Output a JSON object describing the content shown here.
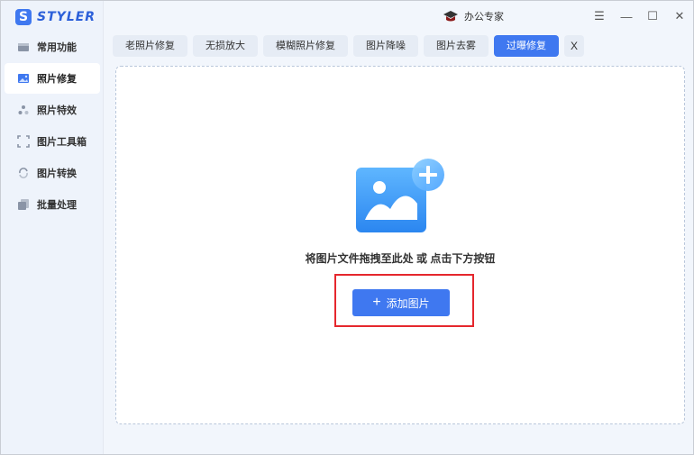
{
  "app": {
    "logo_mark": "S",
    "logo_text": "STYLER"
  },
  "sidebar": {
    "items": [
      {
        "label": "常用功能",
        "icon": "toolbox-icon",
        "active": false
      },
      {
        "label": "照片修复",
        "icon": "photo-icon",
        "active": true
      },
      {
        "label": "照片特效",
        "icon": "effects-icon",
        "active": false
      },
      {
        "label": "图片工具箱",
        "icon": "crop-frame-icon",
        "active": false
      },
      {
        "label": "图片转换",
        "icon": "convert-icon",
        "active": false
      },
      {
        "label": "批量处理",
        "icon": "batch-icon",
        "active": false
      }
    ]
  },
  "titlebar": {
    "office_label": "办公专家",
    "controls": {
      "menu": "☰",
      "minimize": "—",
      "maximize": "☐",
      "close": "✕"
    }
  },
  "tabs": [
    {
      "label": "老照片修复",
      "active": false
    },
    {
      "label": "无损放大",
      "active": false
    },
    {
      "label": "模糊照片修复",
      "active": false
    },
    {
      "label": "图片降噪",
      "active": false
    },
    {
      "label": "图片去雾",
      "active": false
    },
    {
      "label": "过曝修复",
      "active": true
    }
  ],
  "tab_close": "X",
  "main": {
    "hint": "将图片文件拖拽至此处 或 点击下方按钮",
    "add_button_label": "添加图片",
    "add_button_icon": "+"
  },
  "colors": {
    "accent": "#3f78f0",
    "highlight": "#e5272d"
  }
}
